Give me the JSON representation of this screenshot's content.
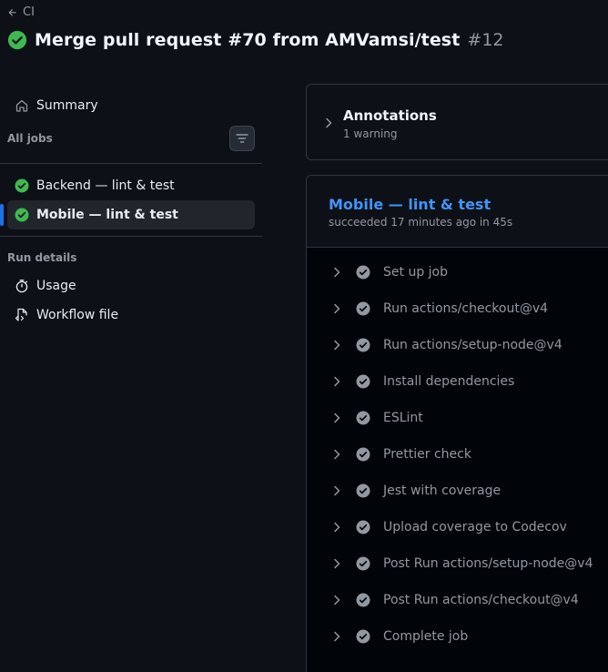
{
  "header": {
    "back_label": "CI",
    "title": "Merge pull request #70 from AMVamsi/test",
    "run_number": "#12",
    "status": "success"
  },
  "sidebar": {
    "summary_label": "Summary",
    "all_jobs_label": "All jobs",
    "jobs": [
      {
        "label": "Backend — lint & test",
        "status": "success"
      },
      {
        "label": "Mobile — lint & test",
        "status": "success",
        "selected": true
      }
    ],
    "run_details_label": "Run details",
    "details": [
      {
        "label": "Usage",
        "icon": "stopwatch-icon"
      },
      {
        "label": "Workflow file",
        "icon": "file-code-icon"
      }
    ]
  },
  "annotations": {
    "title": "Annotations",
    "subtitle": "1 warning"
  },
  "job": {
    "title": "Mobile — lint & test",
    "subtitle": "succeeded 17 minutes ago in 45s",
    "steps": [
      "Set up job",
      "Run actions/checkout@v4",
      "Run actions/setup-node@v4",
      "Install dependencies",
      "ESLint",
      "Prettier check",
      "Jest with coverage",
      "Upload coverage to Codecov",
      "Post Run actions/setup-node@v4",
      "Post Run actions/checkout@v4",
      "Complete job"
    ]
  },
  "colors": {
    "background": "#0d1117",
    "success": "#3fb950",
    "link": "#4493f8",
    "selected_indicator": "#1f6feb",
    "muted_text": "#9198a1"
  }
}
